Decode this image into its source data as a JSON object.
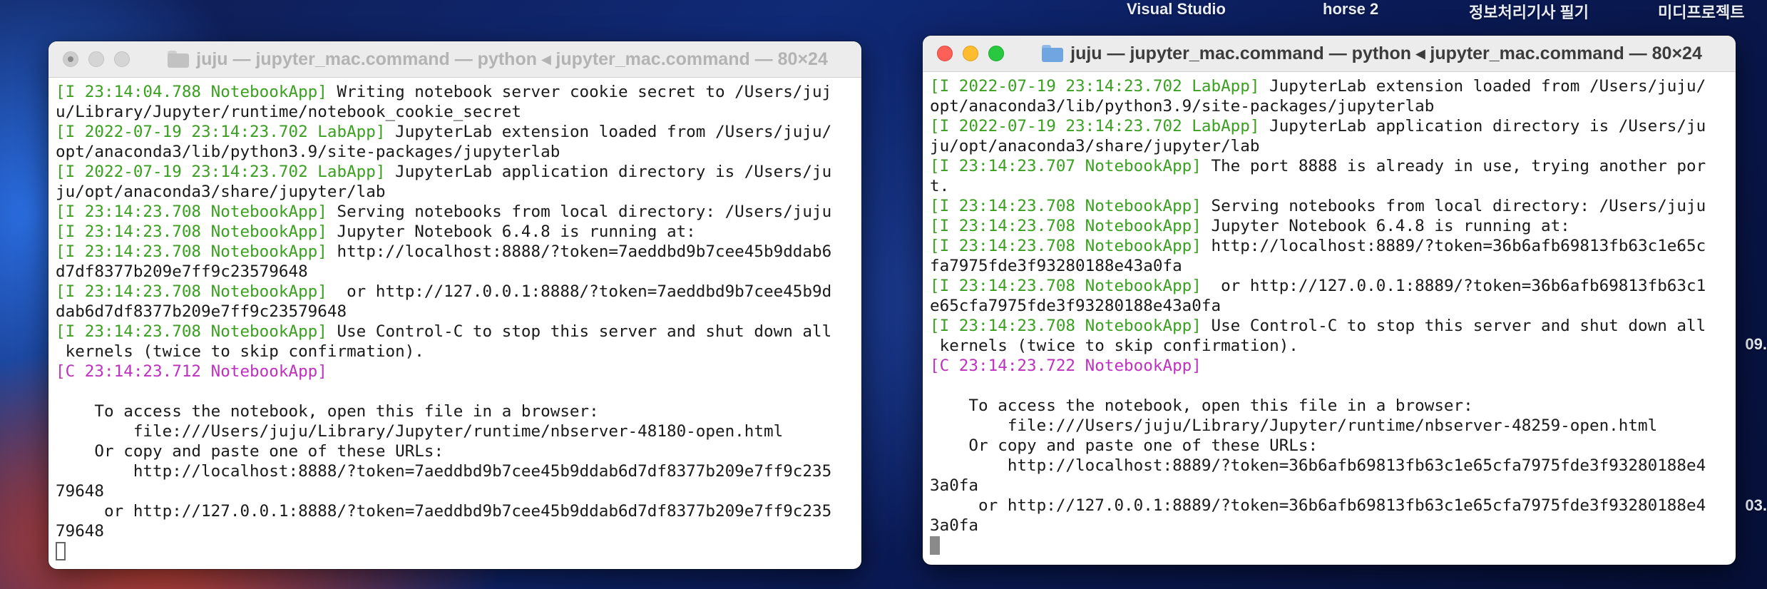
{
  "desktop": {
    "top_labels": [
      "Visual Studio",
      "horse 2",
      "정보처리기사 필기",
      "미디프로젝트"
    ],
    "right_edge": [
      "09.",
      "03."
    ]
  },
  "window_left": {
    "title": "juju — jupyter_mac.command — python ◂ jupyter_mac.command — 80×24",
    "lines": [
      {
        "tag": "[I 23:14:04.788 NotebookApp]",
        "text": " Writing notebook server cookie secret to /Users/juj"
      },
      {
        "tag": "",
        "text": "u/Library/Jupyter/runtime/notebook_cookie_secret"
      },
      {
        "tag": "[I 2022-07-19 23:14:23.702 LabApp]",
        "text": " JupyterLab extension loaded from /Users/juju/"
      },
      {
        "tag": "",
        "text": "opt/anaconda3/lib/python3.9/site-packages/jupyterlab"
      },
      {
        "tag": "[I 2022-07-19 23:14:23.702 LabApp]",
        "text": " JupyterLab application directory is /Users/ju"
      },
      {
        "tag": "",
        "text": "ju/opt/anaconda3/share/jupyter/lab"
      },
      {
        "tag": "[I 23:14:23.708 NotebookApp]",
        "text": " Serving notebooks from local directory: /Users/juju"
      },
      {
        "tag": "[I 23:14:23.708 NotebookApp]",
        "text": " Jupyter Notebook 6.4.8 is running at:"
      },
      {
        "tag": "[I 23:14:23.708 NotebookApp]",
        "text": " http://localhost:8888/?token=7aeddbd9b7cee45b9ddab6"
      },
      {
        "tag": "",
        "text": "d7df8377b209e7ff9c23579648"
      },
      {
        "tag": "[I 23:14:23.708 NotebookApp]",
        "text": "  or http://127.0.0.1:8888/?token=7aeddbd9b7cee45b9d"
      },
      {
        "tag": "",
        "text": "dab6d7df8377b209e7ff9c23579648"
      },
      {
        "tag": "[I 23:14:23.708 NotebookApp]",
        "text": " Use Control-C to stop this server and shut down all"
      },
      {
        "tag": "",
        "text": " kernels (twice to skip confirmation)."
      },
      {
        "tag": "[C 23:14:23.712 NotebookApp]",
        "text": "",
        "magenta": true
      },
      {
        "tag": "",
        "text": ""
      },
      {
        "tag": "",
        "text": "    To access the notebook, open this file in a browser:"
      },
      {
        "tag": "",
        "text": "        file:///Users/juju/Library/Jupyter/runtime/nbserver-48180-open.html"
      },
      {
        "tag": "",
        "text": "    Or copy and paste one of these URLs:"
      },
      {
        "tag": "",
        "text": "        http://localhost:8888/?token=7aeddbd9b7cee45b9ddab6d7df8377b209e7ff9c235"
      },
      {
        "tag": "",
        "text": "79648"
      },
      {
        "tag": "",
        "text": "     or http://127.0.0.1:8888/?token=7aeddbd9b7cee45b9ddab6d7df8377b209e7ff9c235"
      },
      {
        "tag": "",
        "text": "79648"
      }
    ]
  },
  "window_right": {
    "title": "juju — jupyter_mac.command — python ◂ jupyter_mac.command — 80×24",
    "lines": [
      {
        "tag": "[I 2022-07-19 23:14:23.702 LabApp]",
        "text": " JupyterLab extension loaded from /Users/juju/"
      },
      {
        "tag": "",
        "text": "opt/anaconda3/lib/python3.9/site-packages/jupyterlab"
      },
      {
        "tag": "[I 2022-07-19 23:14:23.702 LabApp]",
        "text": " JupyterLab application directory is /Users/ju"
      },
      {
        "tag": "",
        "text": "ju/opt/anaconda3/share/jupyter/lab"
      },
      {
        "tag": "[I 23:14:23.707 NotebookApp]",
        "text": " The port 8888 is already in use, trying another por"
      },
      {
        "tag": "",
        "text": "t."
      },
      {
        "tag": "[I 23:14:23.708 NotebookApp]",
        "text": " Serving notebooks from local directory: /Users/juju"
      },
      {
        "tag": "[I 23:14:23.708 NotebookApp]",
        "text": " Jupyter Notebook 6.4.8 is running at:"
      },
      {
        "tag": "[I 23:14:23.708 NotebookApp]",
        "text": " http://localhost:8889/?token=36b6afb69813fb63c1e65c"
      },
      {
        "tag": "",
        "text": "fa7975fde3f93280188e43a0fa"
      },
      {
        "tag": "[I 23:14:23.708 NotebookApp]",
        "text": "  or http://127.0.0.1:8889/?token=36b6afb69813fb63c1"
      },
      {
        "tag": "",
        "text": "e65cfa7975fde3f93280188e43a0fa"
      },
      {
        "tag": "[I 23:14:23.708 NotebookApp]",
        "text": " Use Control-C to stop this server and shut down all"
      },
      {
        "tag": "",
        "text": " kernels (twice to skip confirmation)."
      },
      {
        "tag": "[C 23:14:23.722 NotebookApp]",
        "text": "",
        "magenta": true
      },
      {
        "tag": "",
        "text": ""
      },
      {
        "tag": "",
        "text": "    To access the notebook, open this file in a browser:"
      },
      {
        "tag": "",
        "text": "        file:///Users/juju/Library/Jupyter/runtime/nbserver-48259-open.html"
      },
      {
        "tag": "",
        "text": "    Or copy and paste one of these URLs:"
      },
      {
        "tag": "",
        "text": "        http://localhost:8889/?token=36b6afb69813fb63c1e65cfa7975fde3f93280188e4"
      },
      {
        "tag": "",
        "text": "3a0fa"
      },
      {
        "tag": "",
        "text": "     or http://127.0.0.1:8889/?token=36b6afb69813fb63c1e65cfa7975fde3f93280188e4"
      },
      {
        "tag": "",
        "text": "3a0fa"
      }
    ]
  }
}
